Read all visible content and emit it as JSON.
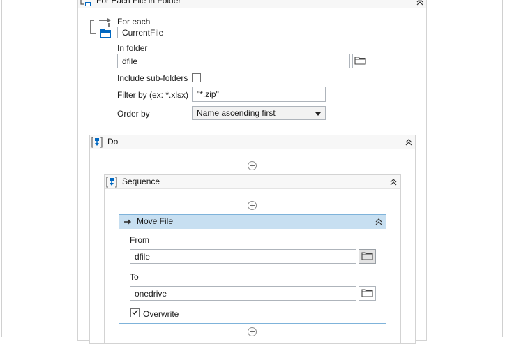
{
  "foreach_activity": {
    "title": "For Each File in Folder",
    "for_each_label": "For each",
    "for_each_value": "CurrentFile",
    "in_folder_label": "In folder",
    "in_folder_value": "dfile",
    "include_subfolders_label": "Include sub-folders",
    "include_subfolders_checked": false,
    "filter_label": "Filter by (ex: *.xlsx)",
    "filter_value": "\"*.zip\"",
    "order_by_label": "Order by",
    "order_by_value": "Name ascending first"
  },
  "do_block": {
    "title": "Do"
  },
  "sequence": {
    "title": "Sequence"
  },
  "move_file": {
    "title": "Move File",
    "from_label": "From",
    "from_value": "dfile",
    "to_label": "To",
    "to_value": "onedrive",
    "overwrite_label": "Overwrite",
    "overwrite_checked": true
  },
  "colors": {
    "accent": "#0067c0",
    "selected_header": "#c7dff1",
    "selected_border": "#7fb3da"
  },
  "icons": [
    "foreach-icon",
    "folder-icon",
    "collapse-icon",
    "do-icon",
    "sequence-icon",
    "move-file-icon",
    "add-activity-icon",
    "checkbox-icon",
    "dropdown-arrow-icon"
  ]
}
